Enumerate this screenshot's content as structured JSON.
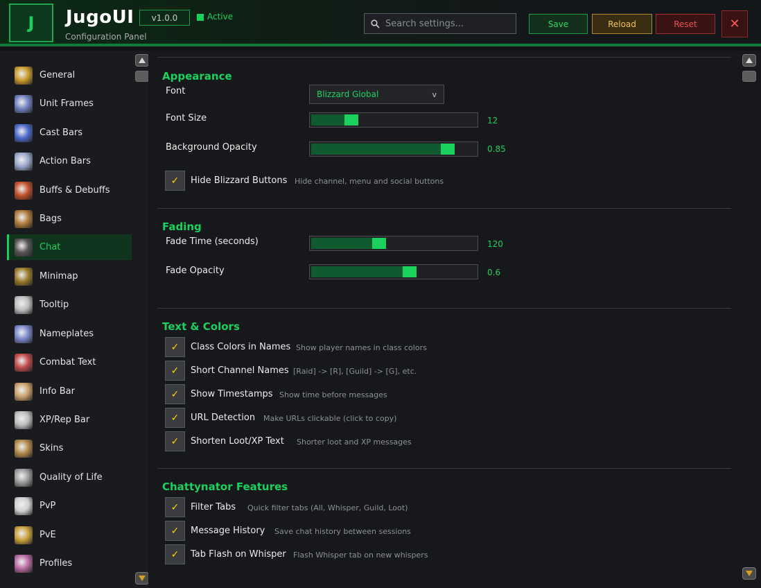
{
  "header": {
    "logo_letter": "J",
    "title": "JugoUI",
    "subtitle": "Configuration Panel",
    "version": "v1.0.0",
    "status": "Active",
    "search_placeholder": "Search settings...",
    "save_label": "Save",
    "reload_label": "Reload",
    "reset_label": "Reset",
    "close_label": "✕"
  },
  "sidebar": {
    "items": [
      {
        "label": "General",
        "icon": "gear-gold-icon",
        "color": "#c79a2b"
      },
      {
        "label": "Unit Frames",
        "icon": "unit-frames-icon",
        "color": "#6f7fbf"
      },
      {
        "label": "Cast Bars",
        "icon": "cast-bars-icon",
        "color": "#4a68c9"
      },
      {
        "label": "Action Bars",
        "icon": "action-bars-icon",
        "color": "#9aa6c9"
      },
      {
        "label": "Buffs & Debuffs",
        "icon": "buffs-icon",
        "color": "#c0502a"
      },
      {
        "label": "Bags",
        "icon": "bag-icon",
        "color": "#b07a3a"
      },
      {
        "label": "Chat",
        "icon": "chat-icon",
        "color": "#555"
      },
      {
        "label": "Minimap",
        "icon": "minimap-icon",
        "color": "#9a7a2a"
      },
      {
        "label": "Tooltip",
        "icon": "tooltip-icon",
        "color": "#bdbdbd"
      },
      {
        "label": "Nameplates",
        "icon": "nameplates-icon",
        "color": "#7a86c9"
      },
      {
        "label": "Combat Text",
        "icon": "combat-text-icon",
        "color": "#c04a4a"
      },
      {
        "label": "Info Bar",
        "icon": "info-bar-icon",
        "color": "#c9a06a"
      },
      {
        "label": "XP/Rep Bar",
        "icon": "xp-rep-icon",
        "color": "#bdbdbd"
      },
      {
        "label": "Skins",
        "icon": "skins-icon",
        "color": "#b08a4a"
      },
      {
        "label": "Quality of Life",
        "icon": "qol-icon",
        "color": "#9a9a9a"
      },
      {
        "label": "PvP",
        "icon": "pvp-icon",
        "color": "#d0d0d0"
      },
      {
        "label": "PvE",
        "icon": "pve-icon",
        "color": "#c9a03a"
      },
      {
        "label": "Profiles",
        "icon": "profiles-icon",
        "color": "#b86aa0"
      }
    ],
    "active_index": 6
  },
  "appearance": {
    "title": "Appearance",
    "font_label": "Font",
    "font_value": "Blizzard Global",
    "font_size_label": "Font Size",
    "font_size_value": "12",
    "font_size_fraction": 0.22,
    "bg_opacity_label": "Background Opacity",
    "bg_opacity_value": "0.85",
    "bg_opacity_fraction": 0.85,
    "hide_buttons_label": "Hide Blizzard Buttons",
    "hide_buttons_desc": "Hide channel, menu and social buttons"
  },
  "fading": {
    "title": "Fading",
    "fade_time_label": "Fade Time (seconds)",
    "fade_time_value": "120",
    "fade_time_fraction": 0.4,
    "fade_opacity_label": "Fade Opacity",
    "fade_opacity_value": "0.6",
    "fade_opacity_fraction": 0.6
  },
  "text_colors": {
    "title": "Text & Colors",
    "options": [
      {
        "label": "Class Colors in Names",
        "desc": "Show player names in class colors"
      },
      {
        "label": "Short Channel Names",
        "desc": "[Raid] -> [R], [Guild] -> [G], etc."
      },
      {
        "label": "Show Timestamps",
        "desc": "Show time before messages"
      },
      {
        "label": "URL Detection",
        "desc": "Make URLs clickable (click to copy)"
      },
      {
        "label": "Shorten Loot/XP Text",
        "desc": "Shorter loot and XP messages"
      }
    ]
  },
  "chattynator": {
    "title": "Chattynator Features",
    "options": [
      {
        "label": "Filter Tabs",
        "desc": "Quick filter tabs (All, Whisper, Guild, Loot)"
      },
      {
        "label": "Message History",
        "desc": "Save chat history between sessions"
      },
      {
        "label": "Tab Flash on Whisper",
        "desc": "Flash Whisper tab on new whispers"
      }
    ]
  },
  "check_mark": "✓",
  "dropdown_chevron": "v",
  "colors": {
    "accent": "#1bd15e",
    "reload": "#f2c24e",
    "reset": "#e85252"
  }
}
